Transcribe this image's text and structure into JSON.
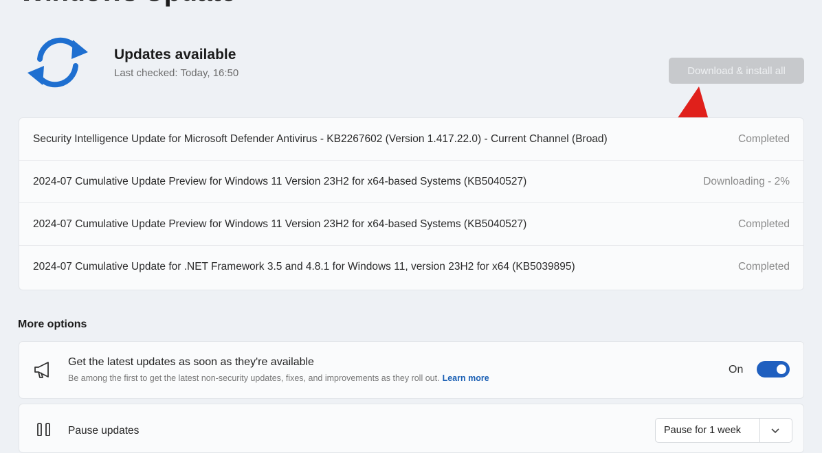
{
  "page": {
    "title": "Windows Update"
  },
  "status": {
    "title": "Updates available",
    "last_checked": "Last checked: Today, 16:50",
    "icon": "sync-icon",
    "icon_color": "#1e6fd0"
  },
  "actions": {
    "download_install_label": "Download & install all"
  },
  "updates": [
    {
      "name": "Security Intelligence Update for Microsoft Defender Antivirus - KB2267602 (Version 1.417.22.0) - Current Channel (Broad)",
      "status": "Completed"
    },
    {
      "name": "2024-07 Cumulative Update Preview for Windows 11 Version 23H2 for x64-based Systems (KB5040527)",
      "status": "Downloading - 2%"
    },
    {
      "name": "2024-07 Cumulative Update Preview for Windows 11 Version 23H2 for x64-based Systems (KB5040527)",
      "status": "Completed"
    },
    {
      "name": "2024-07 Cumulative Update for .NET Framework 3.5 and 4.8.1 for Windows 11, version 23H2 for x64 (KB5039895)",
      "status": "Completed"
    }
  ],
  "more_options": {
    "heading": "More options",
    "latest_updates": {
      "title": "Get the latest updates as soon as they're available",
      "description": "Be among the first to get the latest non-security updates, fixes, and improvements as they roll out.",
      "learn_more": "Learn more",
      "toggle_label": "On",
      "toggle_on": true,
      "icon": "megaphone-icon"
    },
    "pause": {
      "title": "Pause updates",
      "select_value": "Pause for 1 week",
      "icon": "pause-icon"
    }
  },
  "colors": {
    "accent": "#1f5fbf",
    "annotation_arrow": "#e0201b"
  }
}
